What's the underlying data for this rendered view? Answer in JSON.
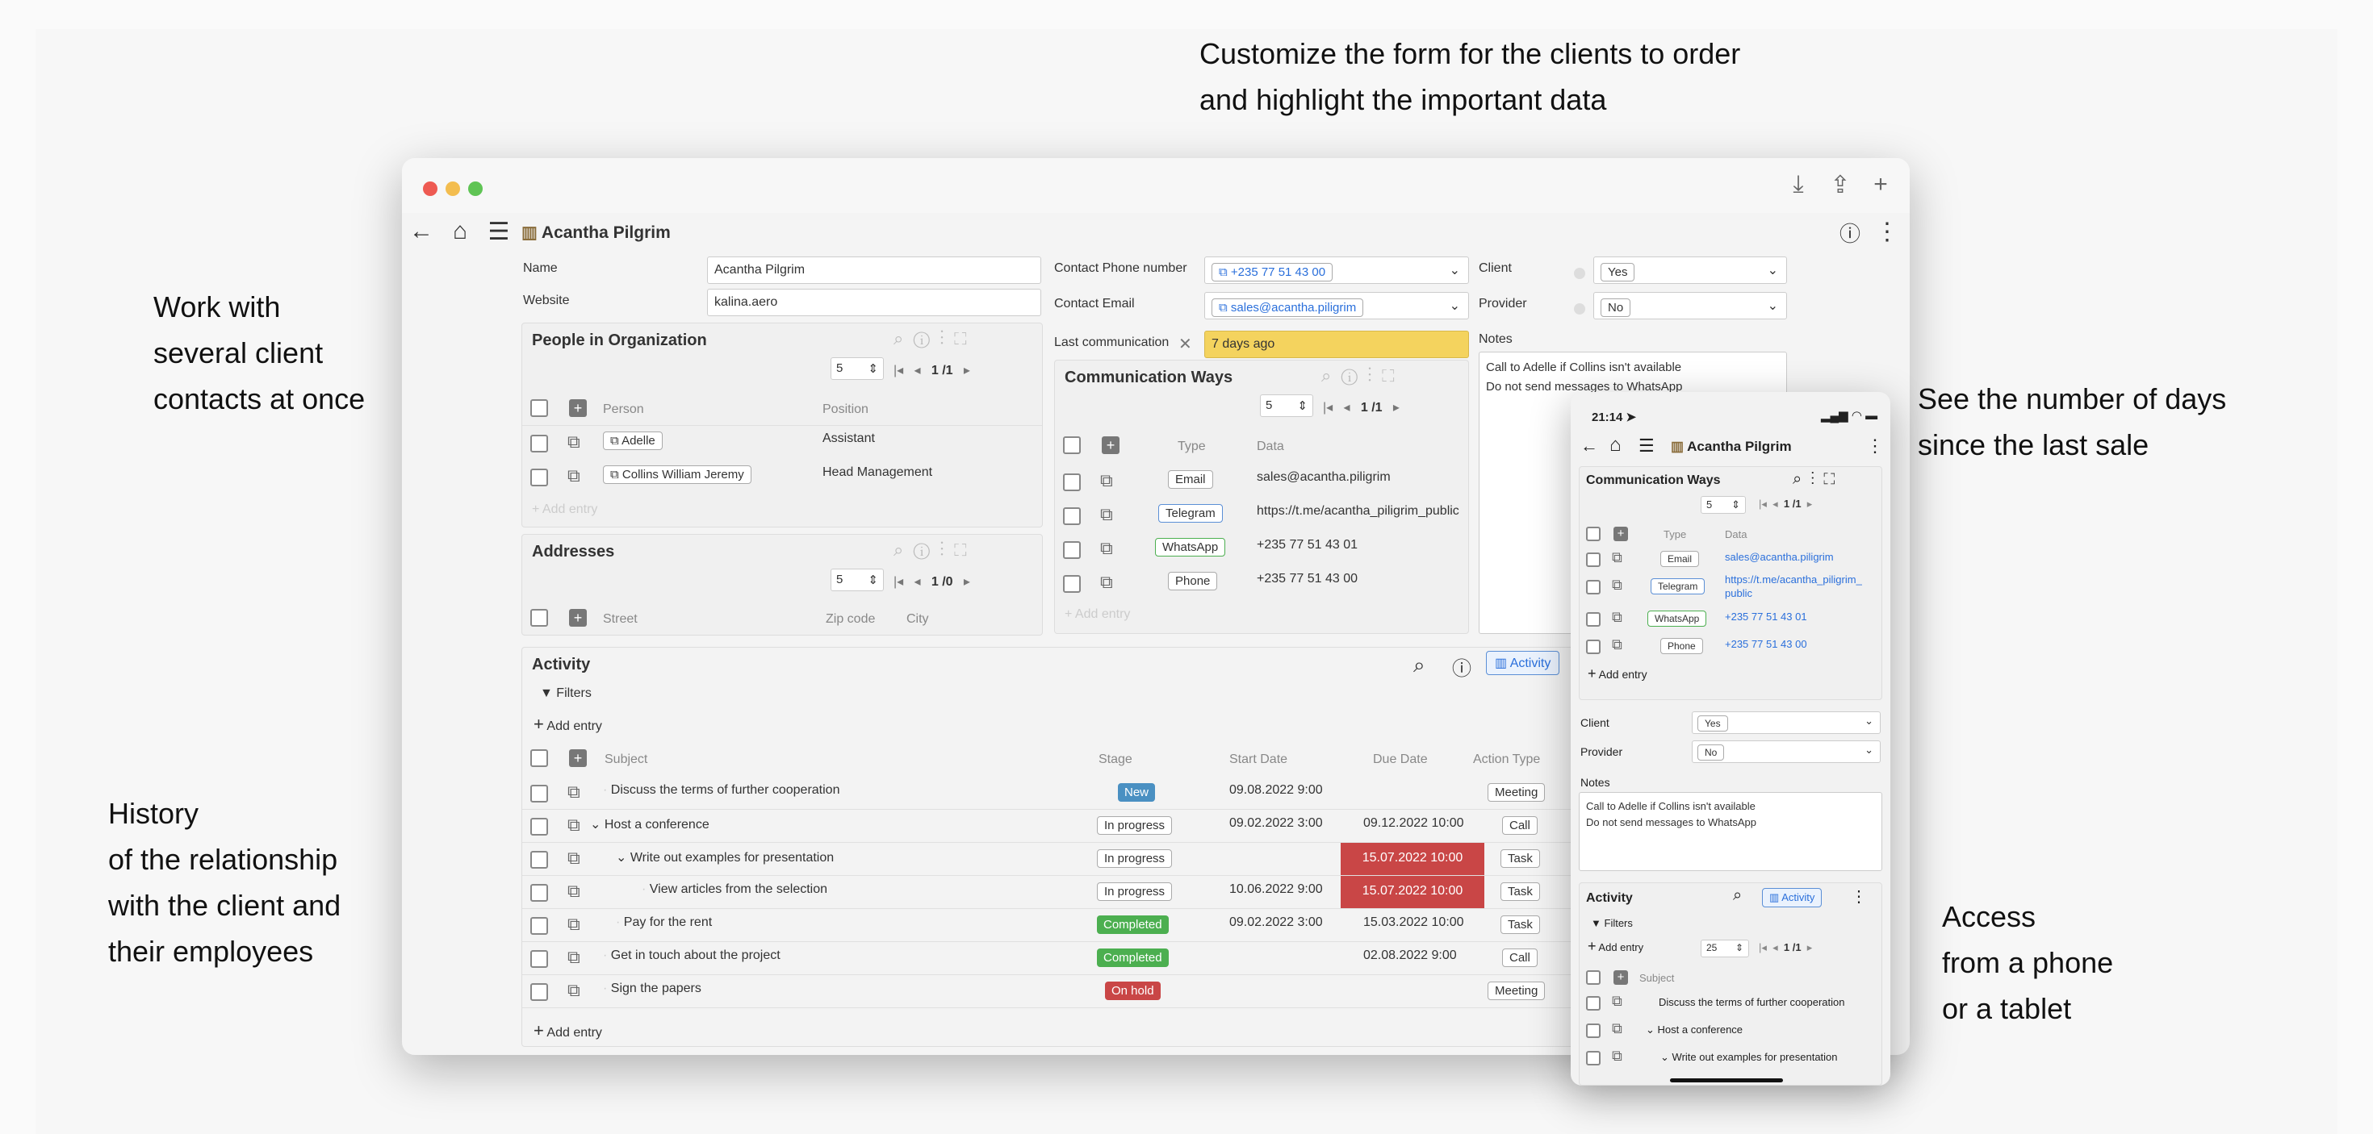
{
  "captions": {
    "top": [
      "Customize the form for the clients to order",
      "and highlight the important data"
    ],
    "left1": [
      "Work with",
      "several client",
      "contacts at once"
    ],
    "left2": [
      "History",
      "of the relationship",
      "with the client and",
      "their employees"
    ],
    "right1": [
      "See the number of days",
      "since the last sale"
    ],
    "right2": [
      "Access",
      "from a phone",
      "or a tablet"
    ]
  },
  "window": {
    "title": "Acantha Pilgrim"
  },
  "form": {
    "name_label": "Name",
    "name_value": "Acantha Pilgrim",
    "website_label": "Website",
    "website_value": "kalina.aero",
    "phone_label": "Contact Phone number",
    "phone_value": "+235 77 51 43 00",
    "email_label": "Contact Email",
    "email_value": "sales@acantha.piligrim",
    "lastcomm_label": "Last communication",
    "lastcomm_value": "7 days ago",
    "client_label": "Client",
    "client_value": "Yes",
    "provider_label": "Provider",
    "provider_value": "No",
    "notes_label": "Notes",
    "notes_lines": [
      "Call to Adelle if Collins isn't available",
      "Do not send messages to WhatsApp"
    ]
  },
  "people": {
    "title": "People in Organization",
    "pagesize": "5",
    "page": "1 /1",
    "col_person": "Person",
    "col_position": "Position",
    "rows": [
      {
        "person": "Adelle",
        "position": "Assistant"
      },
      {
        "person": "Collins William Jeremy",
        "position": "Head Management"
      }
    ],
    "add": "Add entry"
  },
  "addresses": {
    "title": "Addresses",
    "pagesize": "5",
    "page": "1 /0",
    "col_street": "Street",
    "col_zip": "Zip code",
    "col_city": "City"
  },
  "comm": {
    "title": "Communication Ways",
    "pagesize": "5",
    "page": "1 /1",
    "col_type": "Type",
    "col_data": "Data",
    "rows": [
      {
        "type": "Email",
        "data": "sales@acantha.piligrim"
      },
      {
        "type": "Telegram",
        "data": "https://t.me/acantha_piligrim_public"
      },
      {
        "type": "WhatsApp",
        "data": "+235 77 51 43 01"
      },
      {
        "type": "Phone",
        "data": "+235 77 51 43 00"
      }
    ],
    "add": "Add entry"
  },
  "activity": {
    "title": "Activity",
    "view_label": "Activity",
    "filters": "Filters",
    "add_top": "Add entry",
    "add_bottom": "Add entry",
    "cols": {
      "subject": "Subject",
      "stage": "Stage",
      "start": "Start Date",
      "due": "Due Date",
      "type": "Action Type"
    },
    "rows": [
      {
        "subject": "Discuss the terms of further cooperation",
        "stage": "New",
        "start": "09.08.2022 9:00",
        "due": "",
        "type": "Meeting"
      },
      {
        "subject": "Host a conference",
        "stage": "In progress",
        "start": "09.02.2022 3:00",
        "due": "09.12.2022 10:00",
        "type": "Call"
      },
      {
        "subject": "Write out examples for presentation",
        "stage": "In progress",
        "start": "",
        "due": "15.07.2022 10:00",
        "type": "Task"
      },
      {
        "subject": "View articles from the selection",
        "stage": "In progress",
        "start": "10.06.2022 9:00",
        "due": "15.07.2022 10:00",
        "type": "Task"
      },
      {
        "subject": "Pay for the rent",
        "stage": "Completed",
        "start": "09.02.2022 3:00",
        "due": "15.03.2022 10:00",
        "type": "Task"
      },
      {
        "subject": "Get in touch about the project",
        "stage": "Completed",
        "start": "",
        "due": "02.08.2022 9:00",
        "type": "Call"
      },
      {
        "subject": "Sign the papers",
        "stage": "On hold",
        "start": "",
        "due": "",
        "type": "Meeting"
      }
    ]
  },
  "phone": {
    "time": "21:14",
    "title": "Acantha Pilgrim",
    "comm_title": "Communication Ways",
    "pagesize": "5",
    "page": "1 /1",
    "col_type": "Type",
    "col_data": "Data",
    "rows": [
      {
        "type": "Email",
        "data": "sales@acantha.piligrim"
      },
      {
        "type": "Telegram",
        "data": "https://t.me/acantha_piligrim_",
        "data2": "public"
      },
      {
        "type": "WhatsApp",
        "data": "+235 77 51 43 01"
      },
      {
        "type": "Phone",
        "data": "+235 77 51 43 00"
      }
    ],
    "add": "Add entry",
    "client_label": "Client",
    "client_value": "Yes",
    "provider_label": "Provider",
    "provider_value": "No",
    "notes_label": "Notes",
    "notes_lines": [
      "Call to Adelle if Collins isn't available",
      "Do not send messages to WhatsApp"
    ],
    "activity_title": "Activity",
    "view_label": "Activity",
    "filters": "Filters",
    "act_add": "Add entry",
    "act_pagesize": "25",
    "act_page": "1 /1",
    "col_subject": "Subject",
    "act_rows": [
      "Discuss the terms of further cooperation",
      "Host a conference",
      "Write out examples for presentation"
    ]
  },
  "colors": {
    "accent": "#2a6fdb",
    "highlight": "#f4d35e",
    "overdue": "#c94646",
    "new": "#4a90c2",
    "completed": "#4caf50",
    "onhold": "#c94646"
  }
}
